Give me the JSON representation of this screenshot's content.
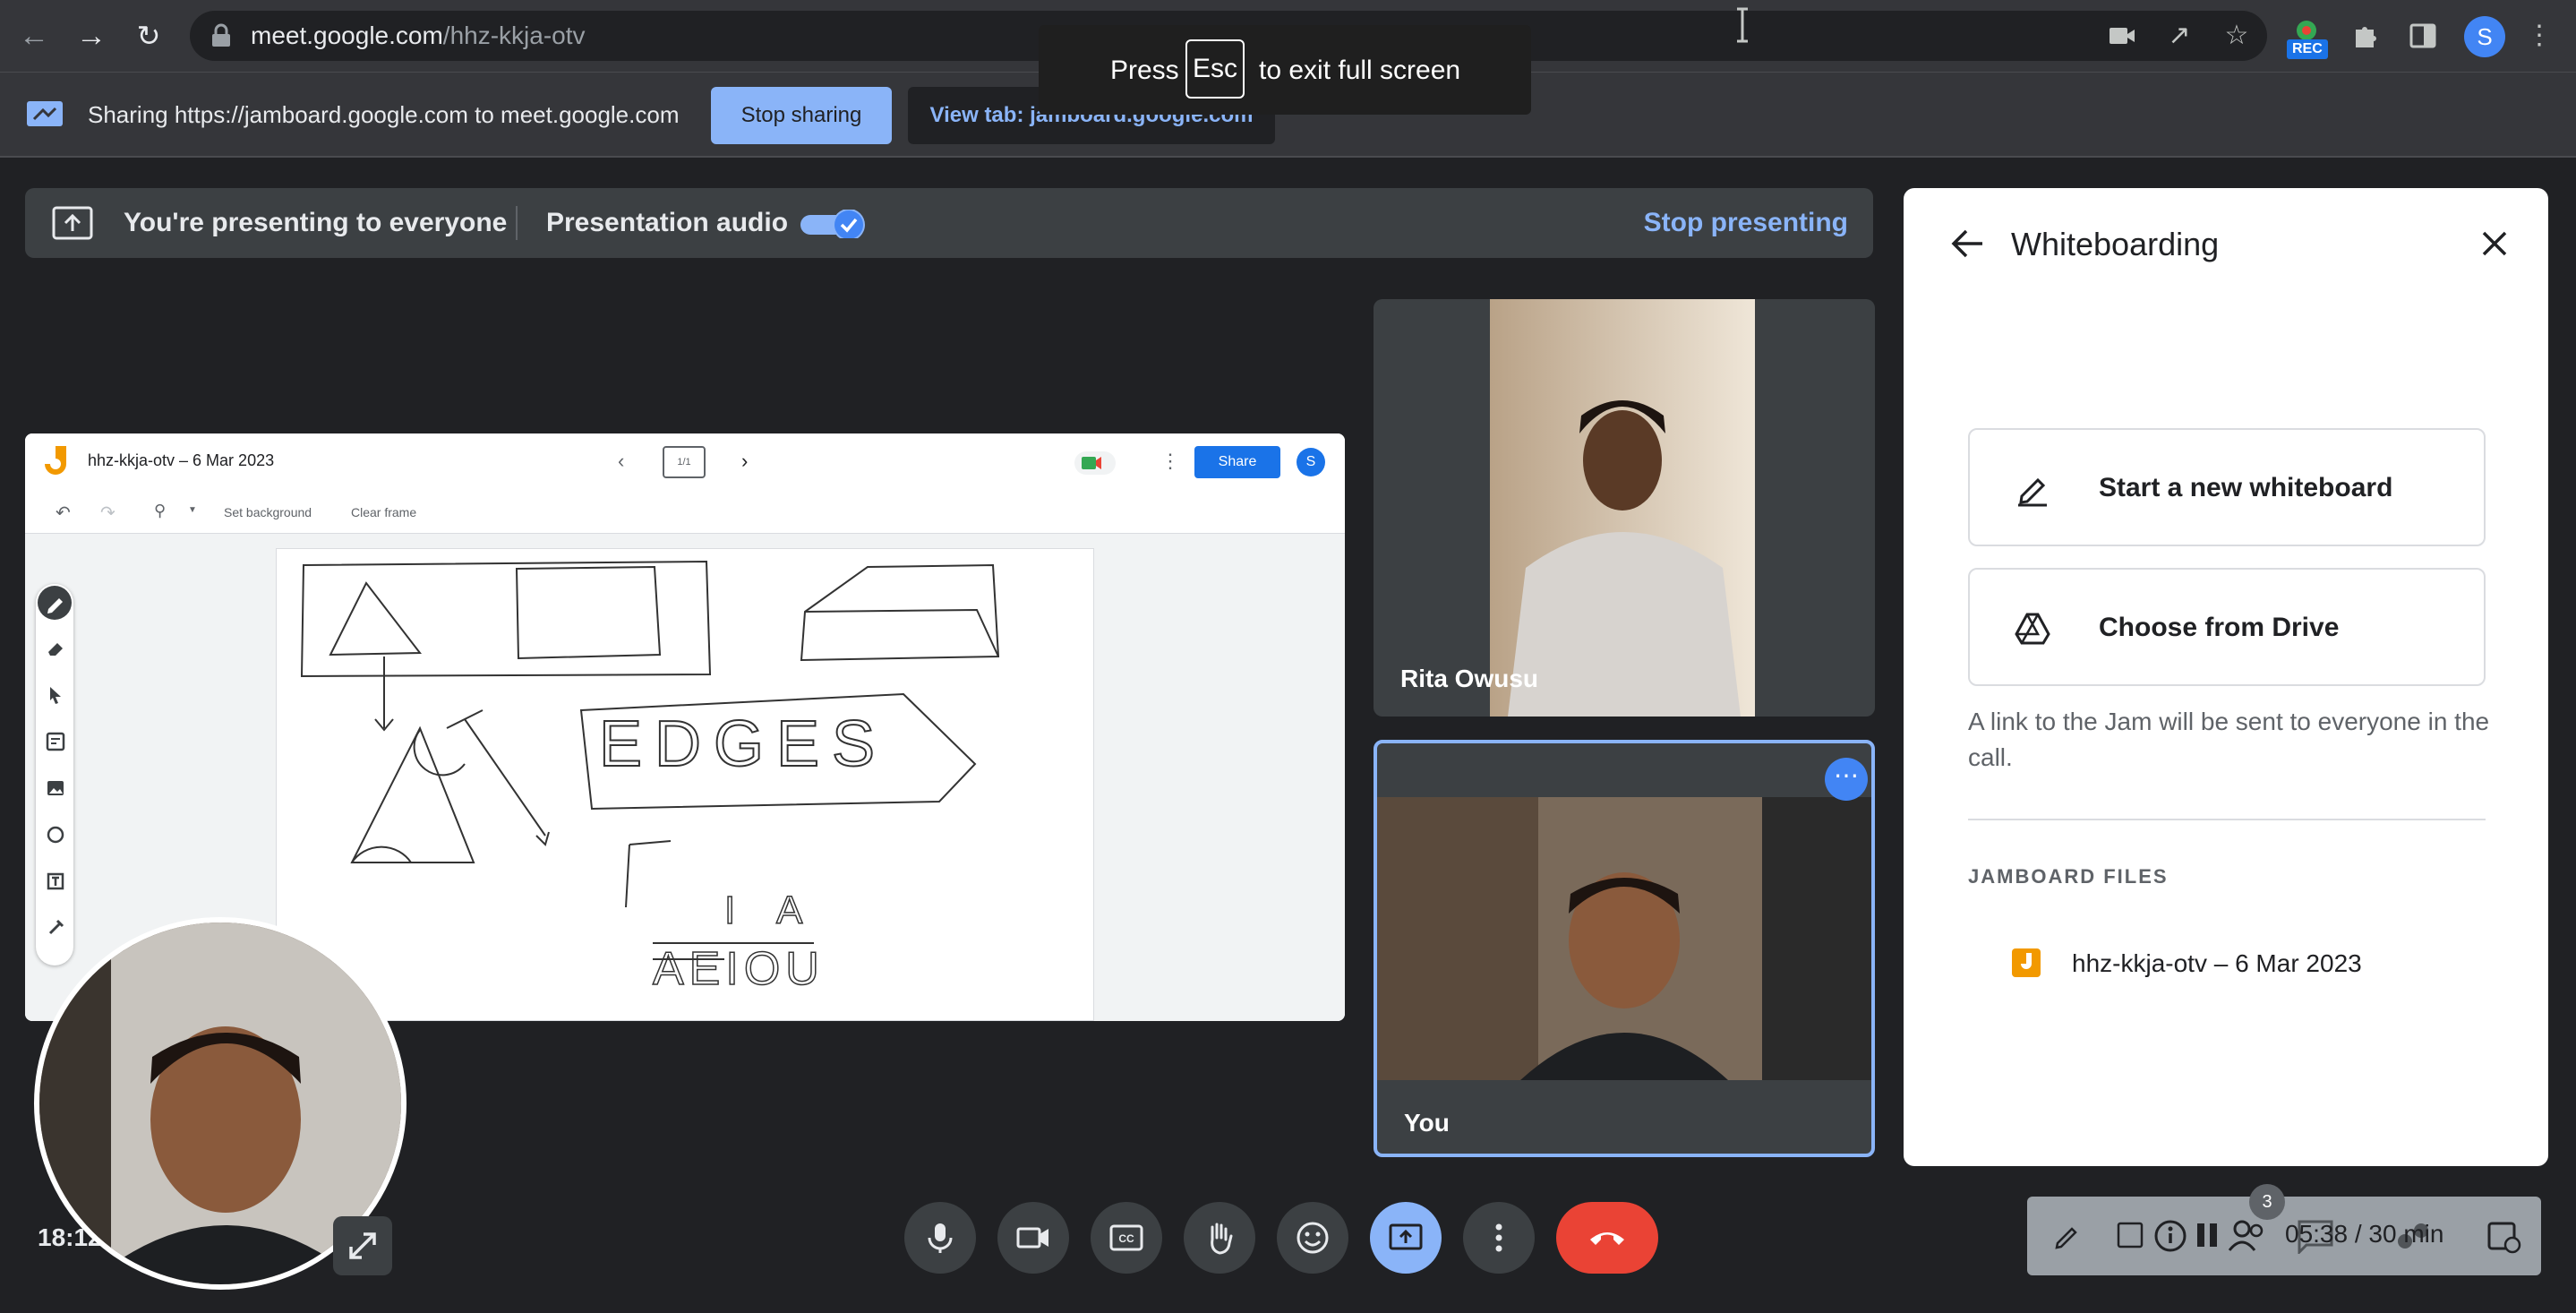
{
  "browser": {
    "url_host": "meet.google.com",
    "url_path": "/hhz-kkja-otv",
    "profile_initial": "S",
    "rec_badge": "REC"
  },
  "sharebar": {
    "message": "Sharing https://jamboard.google.com to meet.google.com",
    "stop_sharing": "Stop sharing",
    "view_tab": "View tab: jamboard.google.com"
  },
  "fullscreen_toast": {
    "press": "Press",
    "key": "Esc",
    "suffix": "to exit full screen"
  },
  "presenting": {
    "message": "You're presenting to everyone",
    "audio_label": "Presentation audio",
    "audio_on": true,
    "stop_label": "Stop presenting"
  },
  "jamboard": {
    "title": "hhz-kkja-otv – 6 Mar 2023",
    "frame_counter": "1/1",
    "share": "Share",
    "avatar": "S",
    "set_background": "Set background",
    "clear_frame": "Clear frame",
    "drawing_text_1": "EDGES",
    "drawing_text_2": "I A",
    "drawing_text_3": "AEIOU"
  },
  "participants": [
    {
      "name": "Rita Owusu"
    },
    {
      "name": "You"
    }
  ],
  "panel": {
    "title": "Whiteboarding",
    "start_new": "Start a new whiteboard",
    "choose_drive": "Choose from Drive",
    "info": "A link to the Jam will be sent to everyone in the call.",
    "section": "JAMBOARD FILES",
    "file_name": "hhz-kkja-otv – 6 Mar 2023"
  },
  "controls": {
    "time": "18:12",
    "participant_count": "3",
    "meeting_timer": "05:38 / 30 min"
  },
  "colors": {
    "accent": "#8ab4f8",
    "end_call": "#ea4335",
    "jam_orange": "#f29900"
  }
}
